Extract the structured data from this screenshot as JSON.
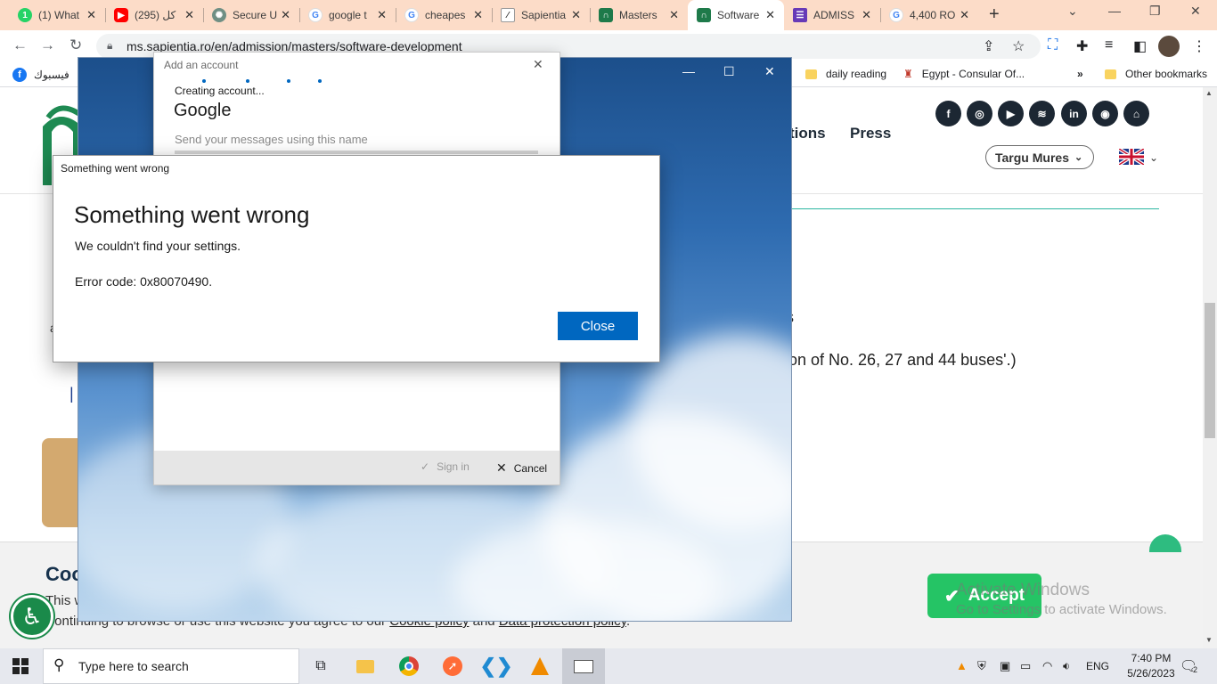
{
  "browser": {
    "tabs": [
      {
        "label": "(1) What",
        "icon": "whatsapp-icon"
      },
      {
        "label": "(295) كل",
        "icon": "youtube-icon"
      },
      {
        "label": "Secure U",
        "icon": "chatgpt-icon"
      },
      {
        "label": "google t",
        "icon": "google-icon"
      },
      {
        "label": "cheapes",
        "icon": "google-icon"
      },
      {
        "label": "Sapientia",
        "icon": "sapientia-icon"
      },
      {
        "label": "Masters",
        "icon": "sapientia-logo-icon"
      },
      {
        "label": "Software",
        "icon": "sapientia-logo-icon",
        "active": true
      },
      {
        "label": "ADMISS",
        "icon": "forms-icon"
      },
      {
        "label": "4,400 RO",
        "icon": "google-icon"
      }
    ],
    "url": "ms.sapientia.ro/en/admission/masters/software-development",
    "bookmarks": {
      "facebook": "فيسبوك",
      "daily": "daily reading",
      "egypt": "Egypt - Consular Of...",
      "more": "»",
      "other": "Other bookmarks"
    }
  },
  "website": {
    "nav": [
      "tions",
      "Press"
    ],
    "city_select": "Targu Mures",
    "bus_text": "on of No.  26, 27 and 44 buses'.)",
    "s_fragment": "s",
    "a_fragment": "a",
    "cookie": {
      "title": "Coo",
      "line1_fragment": "This w",
      "line2_prefix": "y continuing to browse or use this website you agree to our ",
      "cookie_policy": "Cookie policy",
      "and": " and ",
      "data_policy": "Data protection policy",
      "suffix": ".",
      "accept": "Accept"
    }
  },
  "watermark": {
    "line1": "Activate Windows",
    "line2": "Go to Settings to activate Windows."
  },
  "add_account": {
    "title": "Add an account",
    "status": "Creating account...",
    "provider": "Google",
    "hint": "Send your messages using this name",
    "signin": "Sign in",
    "cancel": "Cancel"
  },
  "error_dialog": {
    "caption": "Something went wrong",
    "title": "Something went wrong",
    "message": "We couldn't find your settings.",
    "code": "Error code: 0x80070490.",
    "close": "Close"
  },
  "taskbar": {
    "search_placeholder": "Type here to search",
    "language": "ENG",
    "time": "7:40 PM",
    "date": "5/26/2023",
    "notifications": "2"
  },
  "colors": {
    "tabstrip": "#fcdcc8",
    "accent_blue": "#0067c0",
    "accept_green": "#25c465",
    "site_dark": "#1c2733"
  }
}
